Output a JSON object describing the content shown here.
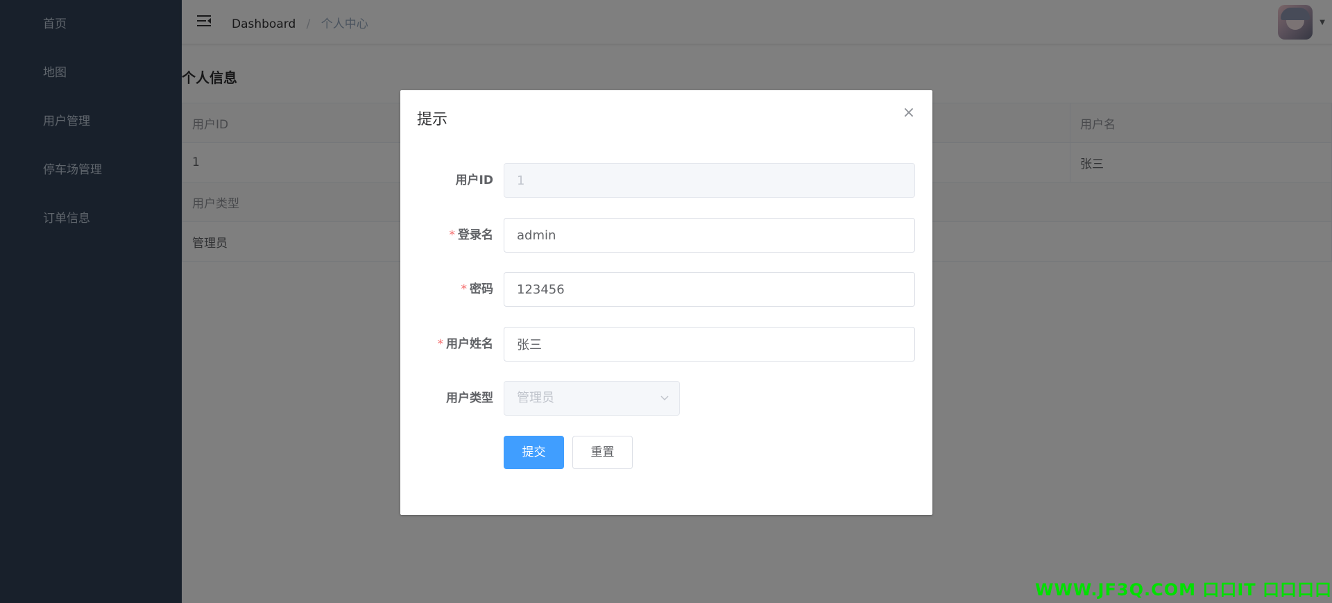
{
  "sidebar": {
    "items": [
      {
        "label": "首页"
      },
      {
        "label": "地图"
      },
      {
        "label": "用户管理"
      },
      {
        "label": "停车场管理"
      },
      {
        "label": "订单信息"
      }
    ]
  },
  "navbar": {
    "breadcrumb": {
      "home": "Dashboard",
      "separator": "/",
      "current": "个人中心"
    }
  },
  "profile": {
    "title": "个人信息",
    "labels": {
      "user_id": "用户ID",
      "username": "用户名",
      "user_type": "用户类型"
    },
    "values": {
      "user_id": "1",
      "username": "张三",
      "user_type": "管理员"
    }
  },
  "dialog": {
    "title": "提示",
    "close_icon": "×",
    "fields": {
      "user_id": {
        "label": "用户ID",
        "value": "1"
      },
      "login_name": {
        "label": "登录名",
        "value": "admin",
        "required_mark": "*"
      },
      "password": {
        "label": "密码",
        "value": "123456",
        "required_mark": "*"
      },
      "real_name": {
        "label": "用户姓名",
        "value": "张三",
        "required_mark": "*"
      },
      "user_type": {
        "label": "用户类型",
        "value": "管理员"
      }
    },
    "buttons": {
      "submit": "提交",
      "reset": "重置"
    }
  },
  "watermark": {
    "text": "WWW.JF3Q.COM 口口IT 口口口口"
  },
  "colors": {
    "sidebar_bg": "#304156",
    "primary": "#409eff",
    "required": "#f56c6c",
    "watermark": "#00e000"
  }
}
